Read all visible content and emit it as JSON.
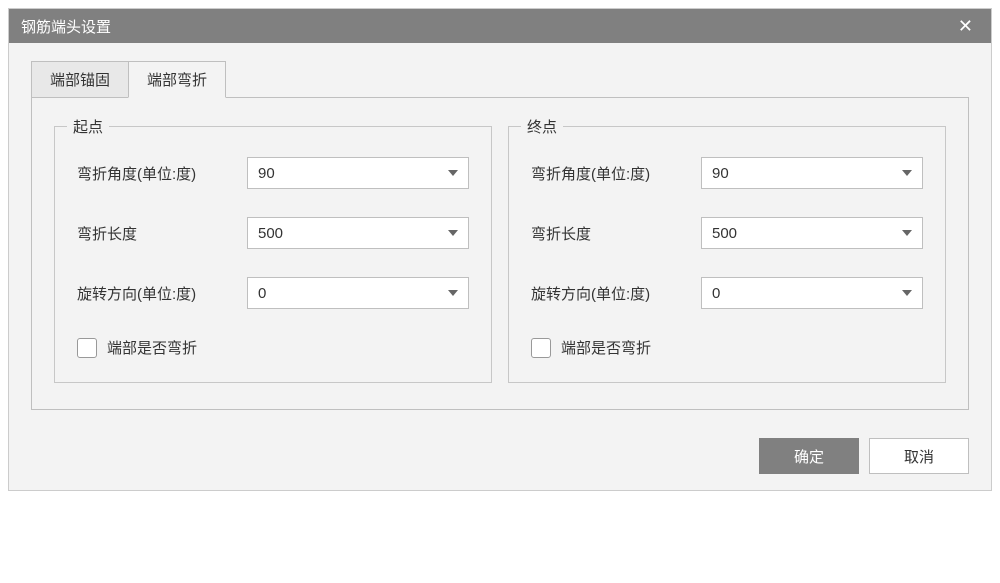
{
  "dialog": {
    "title": "钢筋端头设置",
    "tabs": [
      {
        "label": "端部锚固"
      },
      {
        "label": "端部弯折"
      }
    ],
    "panels": {
      "start": {
        "legend": "起点",
        "angle": {
          "label": "弯折角度(单位:度)",
          "value": "90"
        },
        "length": {
          "label": "弯折长度",
          "value": "500"
        },
        "rotation": {
          "label": "旋转方向(单位:度)",
          "value": "0"
        },
        "bend_check": {
          "label": "端部是否弯折"
        }
      },
      "end": {
        "legend": "终点",
        "angle": {
          "label": "弯折角度(单位:度)",
          "value": "90"
        },
        "length": {
          "label": "弯折长度",
          "value": "500"
        },
        "rotation": {
          "label": "旋转方向(单位:度)",
          "value": "0"
        },
        "bend_check": {
          "label": "端部是否弯折"
        }
      }
    },
    "footer": {
      "ok": "确定",
      "cancel": "取消"
    }
  }
}
